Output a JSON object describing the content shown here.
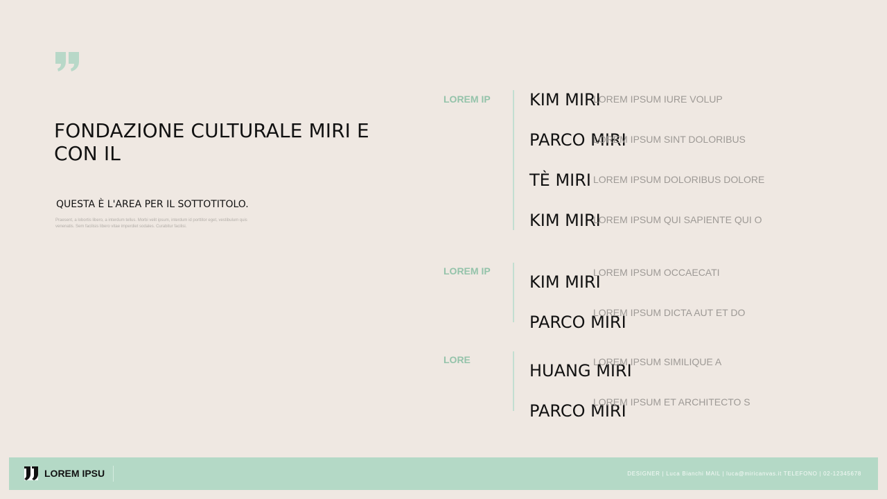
{
  "title": "FONDAZIONE CULTURALE MIRI E CON IL",
  "subtitle": "QUESTA È L'AREA PER IL SOTTOTITOLO.",
  "body_text": "Praesent, a lobortis libero, a interdum tellus. Morbi velit ipsum, interdum id porttitor eget, vestibulum quis venenatis. Sem facilisis libero vitae imperdiet sodales. Curabitur facilisi.",
  "colors": {
    "background": "#efe8e2",
    "accent": "#94c3aa",
    "footer": "#b4d9c6"
  },
  "icons": {
    "quote": "quote-icon",
    "brand": "logo-icon"
  },
  "sections": [
    {
      "label": "LOREM IP",
      "items": [
        {
          "name": "KIM MIRI",
          "desc": "LOREM IPSUM IURE VOLUP"
        },
        {
          "name": "PARCO MIRI",
          "desc": "LOREM IPSUM SINT DOLORIBUS"
        },
        {
          "name": "TÈ MIRI",
          "desc": "LOREM IPSUM DOLORIBUS DOLORE"
        },
        {
          "name": "KIM MIRI",
          "desc": "LOREM IPSUM QUI SAPIENTE QUI O"
        }
      ]
    },
    {
      "label": "LOREM IP",
      "items": [
        {
          "name": "KIM MIRI",
          "desc": "LOREM IPSUM OCCAECATI"
        },
        {
          "name": "PARCO MIRI",
          "desc": "LOREM IPSUM DICTA AUT ET DO"
        }
      ]
    },
    {
      "label": "LORE",
      "items": [
        {
          "name": "HUANG MIRI",
          "desc": "LOREM IPSUM SIMILIQUE A"
        },
        {
          "name": "PARCO MIRI",
          "desc": "LOREM IPSUM ET ARCHITECTO S"
        }
      ]
    }
  ],
  "footer": {
    "brand": "LOREM IPSU",
    "contact": "DESIGNER | Luca Bianchi MAIL | luca@miricanvas.it TELEFONO | 02-12345678"
  }
}
